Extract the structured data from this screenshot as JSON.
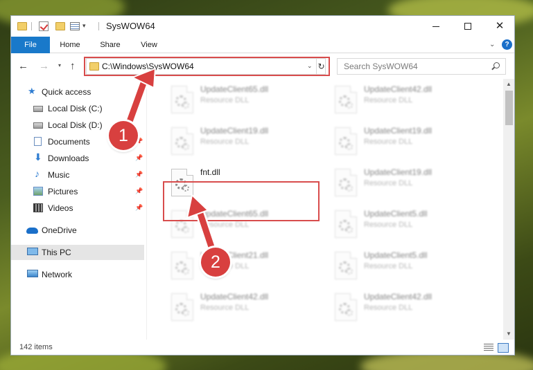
{
  "window": {
    "title": "SysWOW64",
    "controls": {
      "minimize": "minimize-icon",
      "maximize": "maximize-icon",
      "close": "✕"
    }
  },
  "ribbon": {
    "tabs": [
      {
        "label": "File",
        "active": true
      },
      {
        "label": "Home"
      },
      {
        "label": "Share"
      },
      {
        "label": "View"
      }
    ],
    "help": "?"
  },
  "address": {
    "path": "C:\\Windows\\SysWOW64",
    "search_placeholder": "Search SysWOW64"
  },
  "sidebar": {
    "items": [
      {
        "label": "Quick access",
        "icon": "star-icon"
      },
      {
        "label": "Local Disk (C:)",
        "icon": "drive-icon",
        "pinned": true
      },
      {
        "label": "Local Disk (D:)",
        "icon": "drive-icon",
        "pinned": true
      },
      {
        "label": "Documents",
        "icon": "documents-icon",
        "pinned": true
      },
      {
        "label": "Downloads",
        "icon": "downloads-icon",
        "pinned": true
      },
      {
        "label": "Music",
        "icon": "music-icon",
        "pinned": true
      },
      {
        "label": "Pictures",
        "icon": "pictures-icon",
        "pinned": true
      },
      {
        "label": "Videos",
        "icon": "videos-icon",
        "pinned": true
      },
      {
        "label": "OneDrive",
        "icon": "onedrive-icon"
      },
      {
        "label": "This PC",
        "icon": "pc-icon",
        "selected": true
      },
      {
        "label": "Network",
        "icon": "network-icon"
      }
    ]
  },
  "files": [
    {
      "name": "UpdateClient65.dll",
      "type": "Resource DLL"
    },
    {
      "name": "UpdateClient42.dll",
      "type": "Resource DLL"
    },
    {
      "name": "UpdateClient19.dll",
      "type": "Resource DLL"
    },
    {
      "name": "UpdateClient19.dll",
      "type": "Resource DLL"
    },
    {
      "name": "fnt.dll",
      "type": ""
    },
    {
      "name": "UpdateClient19.dll",
      "type": "Resource DLL"
    },
    {
      "name": "UpdateClient65.dll",
      "type": "Resource DLL"
    },
    {
      "name": "UpdateClient5.dll",
      "type": "Resource DLL"
    },
    {
      "name": "UpdateClient21.dll",
      "type": "Resource DLL"
    },
    {
      "name": "UpdateClient5.dll",
      "type": "Resource DLL"
    },
    {
      "name": "UpdateClient42.dll",
      "type": "Resource DLL"
    },
    {
      "name": "UpdateClient42.dll",
      "type": "Resource DLL"
    }
  ],
  "status": {
    "item_count": "142 items"
  },
  "annotations": {
    "step1": "1",
    "step2": "2",
    "highlight_color": "#d84c4c"
  },
  "colors": {
    "accent": "#1979ca",
    "annotation_red": "#d8403f"
  }
}
